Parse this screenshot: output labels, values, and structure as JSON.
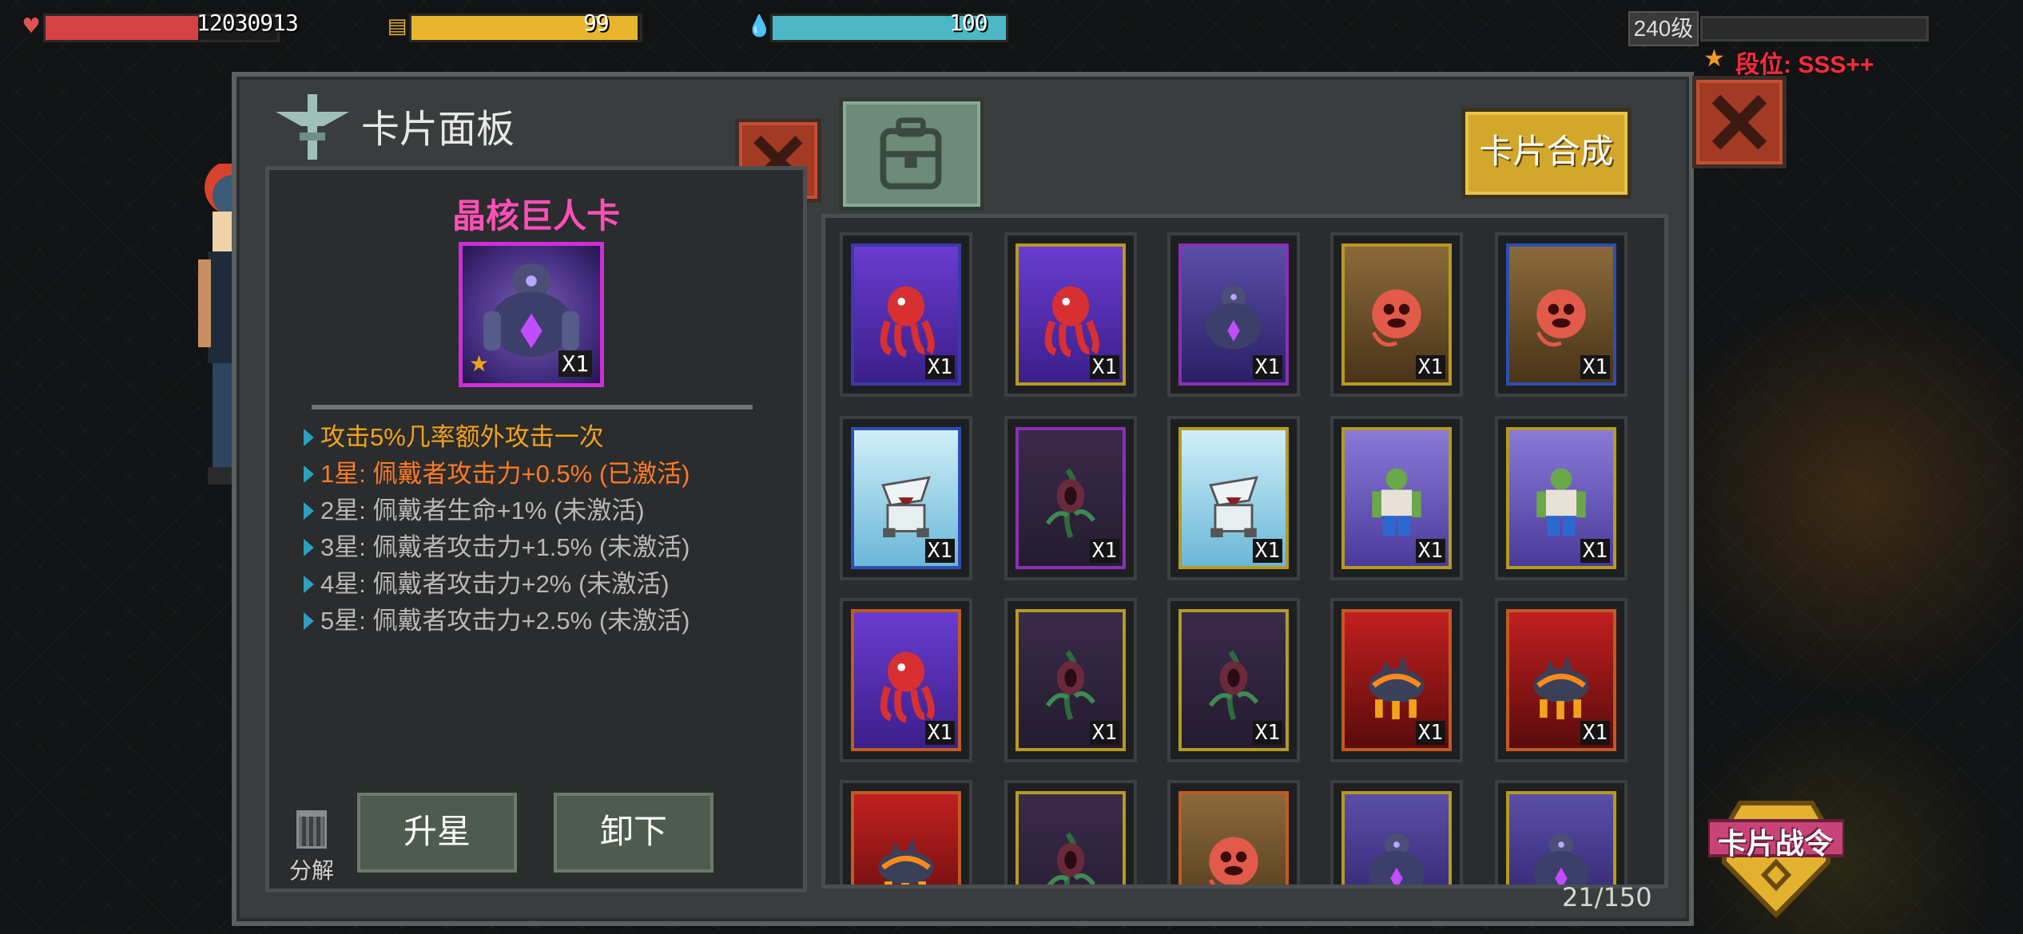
{
  "hud": {
    "health": {
      "value": "12030913",
      "fill": 0.66,
      "color": "#d64141",
      "icon": "heart-icon"
    },
    "energy": {
      "value": "99",
      "fill": 0.99,
      "color": "#e8b52c",
      "icon": "battery-icon"
    },
    "water": {
      "value": "100",
      "fill": 1.0,
      "color": "#4db8c5",
      "icon": "water-drop-icon"
    },
    "level": "240级",
    "xp_fill": 0.0,
    "rank": "段位: SSS++"
  },
  "panel": {
    "title": "卡片面板",
    "synth_button": "卡片合成",
    "capacity": "21/150"
  },
  "detail": {
    "card_name": "晶核巨人卡",
    "card_count": "X1",
    "effects": [
      {
        "text": "攻击5%几率额外攻击一次",
        "state": "main"
      },
      {
        "text": "1星: 佩戴者攻击力+0.5% (已激活)",
        "state": "active"
      },
      {
        "text": "2星: 佩戴者生命+1% (未激活)",
        "state": "inactive"
      },
      {
        "text": "3星: 佩戴者攻击力+1.5% (未激活)",
        "state": "inactive"
      },
      {
        "text": "4星: 佩戴者攻击力+2% (未激活)",
        "state": "inactive"
      },
      {
        "text": "5星: 佩戴者攻击力+2.5% (未激活)",
        "state": "inactive"
      }
    ],
    "decompose_label": "分解",
    "star_up_button": "升星",
    "unequip_button": "卸下"
  },
  "cards": [
    {
      "monster": "red-squid",
      "frame": "#3a3aa8",
      "count": "X1"
    },
    {
      "monster": "red-squid",
      "frame": "#b59a22",
      "count": "X1"
    },
    {
      "monster": "crystal-giant",
      "frame": "#8a2fb8",
      "count": "X1"
    },
    {
      "monster": "flesh-pumpkin",
      "frame": "#b59a22",
      "count": "X1"
    },
    {
      "monster": "flesh-pumpkin",
      "frame": "#2d4eb0",
      "count": "X1"
    },
    {
      "monster": "shark-beast",
      "frame": "#2d4eb0",
      "count": "X1"
    },
    {
      "monster": "vine-plant",
      "frame": "#8a2fb8",
      "count": "X1"
    },
    {
      "monster": "shark-beast",
      "frame": "#b59a22",
      "count": "X1"
    },
    {
      "monster": "green-zombie",
      "frame": "#b59a22",
      "count": "X1"
    },
    {
      "monster": "green-zombie",
      "frame": "#b59a22",
      "count": "X1"
    },
    {
      "monster": "red-squid",
      "frame": "#c25a22",
      "count": "X1"
    },
    {
      "monster": "vine-plant",
      "frame": "#b59a22",
      "count": "X1"
    },
    {
      "monster": "vine-plant",
      "frame": "#b59a22",
      "count": "X1"
    },
    {
      "monster": "lava-beetle",
      "frame": "#c25a22",
      "count": "X1"
    },
    {
      "monster": "lava-beetle",
      "frame": "#c25a22",
      "count": "X1"
    },
    {
      "monster": "lava-beetle",
      "frame": "#c25a22",
      "count": "X1"
    },
    {
      "monster": "vine-plant",
      "frame": "#b59a22",
      "count": "X1"
    },
    {
      "monster": "flesh-pumpkin",
      "frame": "#c25a22",
      "count": "X1"
    },
    {
      "monster": "crystal-giant",
      "frame": "#b59a22",
      "count": "X1"
    },
    {
      "monster": "crystal-giant",
      "frame": "#b59a22",
      "count": "X1"
    }
  ],
  "card_battle_pass": "卡片战令"
}
